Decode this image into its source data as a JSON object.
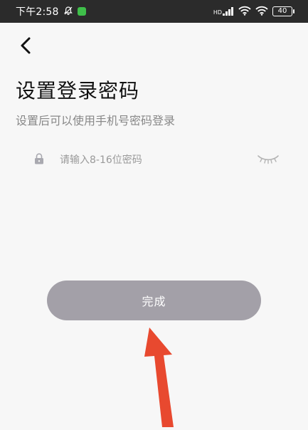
{
  "status_bar": {
    "time": "下午2:58",
    "network_label": "HD",
    "battery": "40"
  },
  "header": {
    "back_icon": "chevron-left-icon"
  },
  "main": {
    "title": "设置登录密码",
    "subtitle": "设置后可以使用手机号密码登录",
    "password_field": {
      "placeholder": "请输入8-16位密码",
      "value": "",
      "lock_icon": "lock-icon",
      "visibility_icon": "eye-closed-icon"
    },
    "done_label": "完成"
  },
  "colors": {
    "status_bar_bg": "#2b2b2b",
    "page_bg": "#f7f7f7",
    "button_disabled": "#a3a0a8",
    "annotation_arrow": "#e8492f"
  }
}
